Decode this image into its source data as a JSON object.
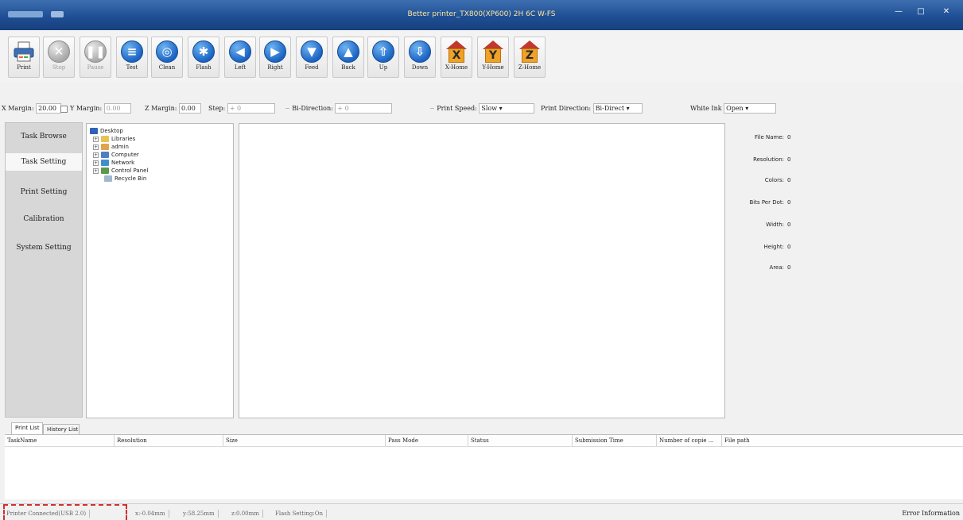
{
  "window": {
    "title": "Better printer_TX800(XP600) 2H 6C W-FS",
    "minimize": "—",
    "maximize": "□",
    "close": "✕"
  },
  "toolbar": [
    {
      "id": "print",
      "label": "Print",
      "icon": "printer-icon"
    },
    {
      "id": "stop",
      "label": "Stop",
      "icon": "stop-icon",
      "glyph": "✕",
      "disabled": true
    },
    {
      "id": "pause",
      "label": "Pause",
      "icon": "pause-icon",
      "glyph": "❚❚",
      "disabled": true
    },
    {
      "id": "test",
      "label": "Test",
      "icon": "test-icon",
      "glyph": "≡"
    },
    {
      "id": "clean",
      "label": "Clean",
      "icon": "clean-icon",
      "glyph": "◎"
    },
    {
      "id": "flash",
      "label": "Flash",
      "icon": "flash-icon",
      "glyph": "✱"
    },
    {
      "id": "left",
      "label": "Left",
      "icon": "arrow-left-icon",
      "glyph": "◀"
    },
    {
      "id": "right",
      "label": "Right",
      "icon": "arrow-right-icon",
      "glyph": "▶"
    },
    {
      "id": "feed",
      "label": "Feed",
      "icon": "arrow-down-icon",
      "glyph": "▼"
    },
    {
      "id": "back",
      "label": "Back",
      "icon": "arrow-up-icon",
      "glyph": "▲"
    },
    {
      "id": "up",
      "label": "Up",
      "icon": "carriage-up-icon",
      "glyph": "⇧"
    },
    {
      "id": "down",
      "label": "Down",
      "icon": "carriage-down-icon",
      "glyph": "⇩"
    },
    {
      "id": "xhome",
      "label": "X-Home",
      "icon": "x-home-icon",
      "letter": "X"
    },
    {
      "id": "yhome",
      "label": "Y-Home",
      "icon": "y-home-icon",
      "letter": "Y"
    },
    {
      "id": "zhome",
      "label": "Z-Home",
      "icon": "z-home-icon",
      "letter": "Z"
    }
  ],
  "settings": {
    "x_margin_label": "X Margin:",
    "x_margin_value": "20.00",
    "y_margin_label": "Y Margin:",
    "y_margin_value": "0.00",
    "z_margin_label": "Z Margin:",
    "z_margin_value": "0.00",
    "step_label": "Step:",
    "step_value": "0",
    "bidir_label": "Bi-Direction:",
    "bidir_value": "0",
    "print_speed_label": "Print Speed:",
    "print_speed_value": "Slow",
    "print_direction_label": "Print Direction:",
    "print_direction_value": "Bi-Direct",
    "white_ink_label": "White Ink",
    "white_ink_value": "Open"
  },
  "nav": [
    "Task Browse",
    "Task Setting",
    "Print Setting",
    "Calibration",
    "System Setting"
  ],
  "tree": [
    "Desktop",
    "Libraries",
    "admin",
    "Computer",
    "Network",
    "Control Panel",
    "Recycle Bin"
  ],
  "info": [
    {
      "label": "File Name:",
      "value": "0"
    },
    {
      "label": "Resolution:",
      "value": "0"
    },
    {
      "label": "Colors:",
      "value": "0"
    },
    {
      "label": "Bits Per Dot:",
      "value": "0"
    },
    {
      "label": "Width:",
      "value": "0"
    },
    {
      "label": "Height:",
      "value": "0"
    },
    {
      "label": "Area:",
      "value": "0"
    }
  ],
  "tabs": [
    "Print List",
    "History List"
  ],
  "columns": [
    "TaskName",
    "Resolution",
    "Size",
    "Pass Mode",
    "Status",
    "Submission Time",
    "Number of copie ...",
    "File path"
  ],
  "status": {
    "connection": "Printer Connected(USB 2.0)",
    "x_pos": "x:-0.04mm",
    "y_pos": "y:58.25mm",
    "z_pos": "z:0.00mm",
    "flash": "Flash Setting:On",
    "error": "Error Information"
  },
  "colors": {
    "titlebar": "#1f4f95",
    "highlight": "#d32f2f",
    "home_body": "#f0a127"
  }
}
